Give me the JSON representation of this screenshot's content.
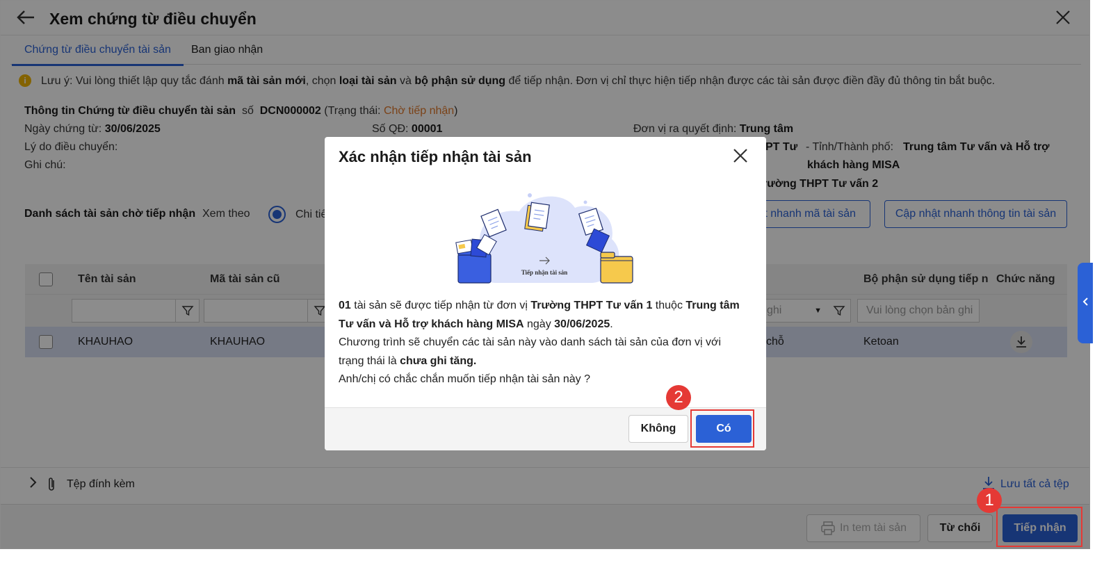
{
  "header": {
    "title": "Xem chứng từ điều chuyển"
  },
  "tabs": [
    {
      "label": "Chứng từ điều chuyển tài sản"
    },
    {
      "label": "Ban giao nhận"
    }
  ],
  "notice": {
    "p1": "Lưu ý: Vui lòng thiết lập quy tắc đánh ",
    "b1": "mã tài sản mới",
    "p2": ", chọn ",
    "b2": "loại tài sản",
    "p3": " và ",
    "b3": "bộ phận sử dụng",
    "p4": " để tiếp nhận. Đơn vị chỉ thực hiện tiếp nhận được các tài sản được điền đầy đủ thông tin bắt buộc."
  },
  "doc_info": {
    "heading": "Thông tin Chứng từ điều chuyển tài sản",
    "so_label": "số",
    "so_value": "DCN000002",
    "status_open": "(Trạng thái: ",
    "status": "Chờ tiếp nhận",
    "status_close": ")",
    "date_label": "Ngày chứng từ:",
    "date_value": "30/06/2025",
    "qd_label": "Số QĐ:",
    "qd_value": "00001",
    "unit_label": "Đơn vị ra quyết định:",
    "unit_value": "Trung tâm",
    "reason_label": "Lý do điều chuyển:",
    "note_label": "Ghi chú:",
    "partial_1": "PT Tư",
    "province_label": "- Tỉnh/Thành phố:",
    "province_value_1": "Trung tâm Tư vấn và Hỗ trợ",
    "province_value_2": "khách hàng MISA",
    "partial_2": "rường THPT Tư vấn 2"
  },
  "list": {
    "label": "Danh sách tài sản chờ tiếp nhận",
    "view_by": "Xem theo",
    "radio_partial": "Chi tiế",
    "btn_partial": "ật nhanh mã tài sản",
    "btn_update_info": "Cập nhật nhanh thông tin tài sản"
  },
  "grid": {
    "col_name": "Tên tài sản",
    "col_old_code": "Mã tài sản cũ",
    "col_dept": "Bộ phận sử dụng tiếp n",
    "col_func": "Chức năng",
    "filter_partial": "ghi",
    "dept_placeholder": "Vui lòng chọn bản ghi",
    "row": {
      "name": "KHAUHAO",
      "old_code": "KHAUHAO",
      "partial": "chỗ",
      "dept": "Ketoan"
    }
  },
  "attachments": {
    "label": "Tệp đính kèm",
    "save_all": "Lưu tất cả tệp"
  },
  "footer": {
    "print": "In tem tài sản",
    "reject": "Từ chối",
    "accept": "Tiếp nhận"
  },
  "dialog": {
    "title": "Xác nhận tiếp nhận tài sản",
    "illustration_label": "Tiếp nhận tài sản",
    "l1_b1": "01",
    "l1_t1": " tài sản sẽ được tiếp nhận từ đơn vị ",
    "l1_b2": "Trường THPT Tư vấn 1",
    "l1_t2": " thuộc ",
    "l1_b3": "Trung tâm",
    "l2_b1": "Tư vấn và Hỗ trợ khách hàng MISA",
    "l2_t1": " ngày ",
    "l2_b2": "30/06/2025",
    "l2_t2": ".",
    "l3": "Chương trình sẽ chuyển các tài sản này vào danh sách tài sản của đơn vị với",
    "l4_t1": "trạng thái là ",
    "l4_b1": "chưa ghi tăng.",
    "l5": "Anh/chị có chắc chắn muốn tiếp nhận tài sản này ?",
    "btn_no": "Không",
    "btn_yes": "Có"
  },
  "annotations": {
    "step1": "1",
    "step2": "2"
  },
  "colors": {
    "primary": "#2b61d6",
    "status": "#e0782a",
    "highlight": "#e53935",
    "row_selected": "#d8def3"
  },
  "icons": {
    "back": "arrow-left-icon",
    "close": "close-icon",
    "filter": "filter-icon",
    "download": "download-icon",
    "attach": "paperclip-icon",
    "printer": "printer-icon"
  }
}
